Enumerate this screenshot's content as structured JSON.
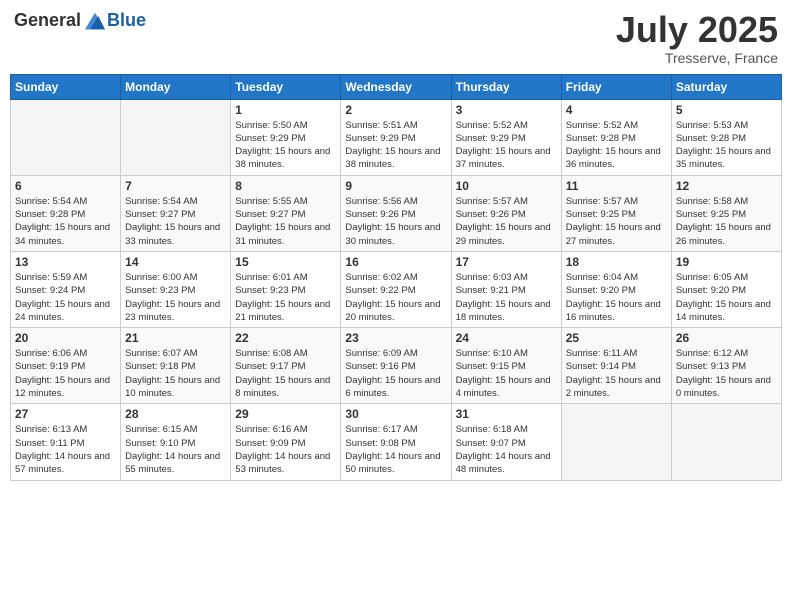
{
  "header": {
    "logo_general": "General",
    "logo_blue": "Blue",
    "month": "July 2025",
    "location": "Tresserve, France"
  },
  "weekdays": [
    "Sunday",
    "Monday",
    "Tuesday",
    "Wednesday",
    "Thursday",
    "Friday",
    "Saturday"
  ],
  "weeks": [
    [
      {
        "day": "",
        "info": ""
      },
      {
        "day": "",
        "info": ""
      },
      {
        "day": "1",
        "info": "Sunrise: 5:50 AM\nSunset: 9:29 PM\nDaylight: 15 hours and 38 minutes."
      },
      {
        "day": "2",
        "info": "Sunrise: 5:51 AM\nSunset: 9:29 PM\nDaylight: 15 hours and 38 minutes."
      },
      {
        "day": "3",
        "info": "Sunrise: 5:52 AM\nSunset: 9:29 PM\nDaylight: 15 hours and 37 minutes."
      },
      {
        "day": "4",
        "info": "Sunrise: 5:52 AM\nSunset: 9:28 PM\nDaylight: 15 hours and 36 minutes."
      },
      {
        "day": "5",
        "info": "Sunrise: 5:53 AM\nSunset: 9:28 PM\nDaylight: 15 hours and 35 minutes."
      }
    ],
    [
      {
        "day": "6",
        "info": "Sunrise: 5:54 AM\nSunset: 9:28 PM\nDaylight: 15 hours and 34 minutes."
      },
      {
        "day": "7",
        "info": "Sunrise: 5:54 AM\nSunset: 9:27 PM\nDaylight: 15 hours and 33 minutes."
      },
      {
        "day": "8",
        "info": "Sunrise: 5:55 AM\nSunset: 9:27 PM\nDaylight: 15 hours and 31 minutes."
      },
      {
        "day": "9",
        "info": "Sunrise: 5:56 AM\nSunset: 9:26 PM\nDaylight: 15 hours and 30 minutes."
      },
      {
        "day": "10",
        "info": "Sunrise: 5:57 AM\nSunset: 9:26 PM\nDaylight: 15 hours and 29 minutes."
      },
      {
        "day": "11",
        "info": "Sunrise: 5:57 AM\nSunset: 9:25 PM\nDaylight: 15 hours and 27 minutes."
      },
      {
        "day": "12",
        "info": "Sunrise: 5:58 AM\nSunset: 9:25 PM\nDaylight: 15 hours and 26 minutes."
      }
    ],
    [
      {
        "day": "13",
        "info": "Sunrise: 5:59 AM\nSunset: 9:24 PM\nDaylight: 15 hours and 24 minutes."
      },
      {
        "day": "14",
        "info": "Sunrise: 6:00 AM\nSunset: 9:23 PM\nDaylight: 15 hours and 23 minutes."
      },
      {
        "day": "15",
        "info": "Sunrise: 6:01 AM\nSunset: 9:23 PM\nDaylight: 15 hours and 21 minutes."
      },
      {
        "day": "16",
        "info": "Sunrise: 6:02 AM\nSunset: 9:22 PM\nDaylight: 15 hours and 20 minutes."
      },
      {
        "day": "17",
        "info": "Sunrise: 6:03 AM\nSunset: 9:21 PM\nDaylight: 15 hours and 18 minutes."
      },
      {
        "day": "18",
        "info": "Sunrise: 6:04 AM\nSunset: 9:20 PM\nDaylight: 15 hours and 16 minutes."
      },
      {
        "day": "19",
        "info": "Sunrise: 6:05 AM\nSunset: 9:20 PM\nDaylight: 15 hours and 14 minutes."
      }
    ],
    [
      {
        "day": "20",
        "info": "Sunrise: 6:06 AM\nSunset: 9:19 PM\nDaylight: 15 hours and 12 minutes."
      },
      {
        "day": "21",
        "info": "Sunrise: 6:07 AM\nSunset: 9:18 PM\nDaylight: 15 hours and 10 minutes."
      },
      {
        "day": "22",
        "info": "Sunrise: 6:08 AM\nSunset: 9:17 PM\nDaylight: 15 hours and 8 minutes."
      },
      {
        "day": "23",
        "info": "Sunrise: 6:09 AM\nSunset: 9:16 PM\nDaylight: 15 hours and 6 minutes."
      },
      {
        "day": "24",
        "info": "Sunrise: 6:10 AM\nSunset: 9:15 PM\nDaylight: 15 hours and 4 minutes."
      },
      {
        "day": "25",
        "info": "Sunrise: 6:11 AM\nSunset: 9:14 PM\nDaylight: 15 hours and 2 minutes."
      },
      {
        "day": "26",
        "info": "Sunrise: 6:12 AM\nSunset: 9:13 PM\nDaylight: 15 hours and 0 minutes."
      }
    ],
    [
      {
        "day": "27",
        "info": "Sunrise: 6:13 AM\nSunset: 9:11 PM\nDaylight: 14 hours and 57 minutes."
      },
      {
        "day": "28",
        "info": "Sunrise: 6:15 AM\nSunset: 9:10 PM\nDaylight: 14 hours and 55 minutes."
      },
      {
        "day": "29",
        "info": "Sunrise: 6:16 AM\nSunset: 9:09 PM\nDaylight: 14 hours and 53 minutes."
      },
      {
        "day": "30",
        "info": "Sunrise: 6:17 AM\nSunset: 9:08 PM\nDaylight: 14 hours and 50 minutes."
      },
      {
        "day": "31",
        "info": "Sunrise: 6:18 AM\nSunset: 9:07 PM\nDaylight: 14 hours and 48 minutes."
      },
      {
        "day": "",
        "info": ""
      },
      {
        "day": "",
        "info": ""
      }
    ]
  ]
}
